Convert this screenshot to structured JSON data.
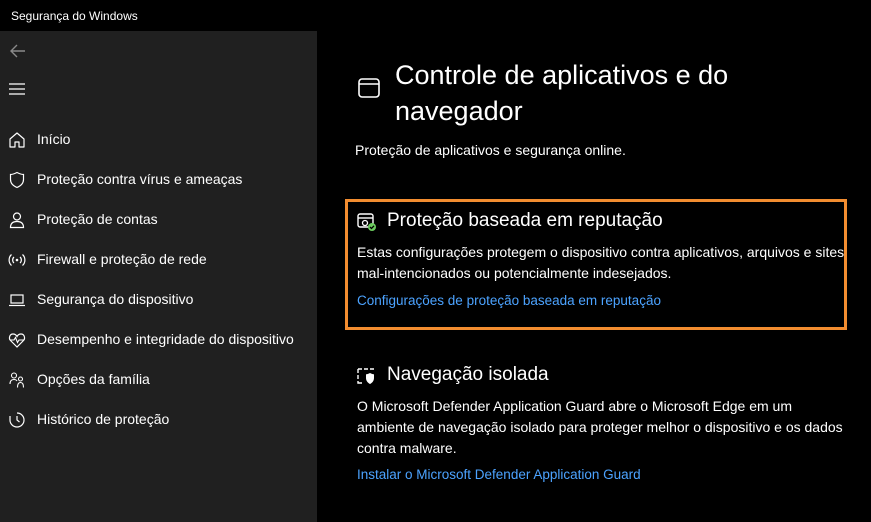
{
  "app": {
    "title": "Segurança do Windows"
  },
  "sidebar": {
    "back_icon": "back-arrow-icon",
    "menu_icon": "hamburger-menu-icon",
    "items": [
      {
        "label": "Início",
        "icon": "home-icon"
      },
      {
        "label": "Proteção contra vírus e ameaças",
        "icon": "shield-icon"
      },
      {
        "label": "Proteção de contas",
        "icon": "person-icon"
      },
      {
        "label": "Firewall e proteção de rede",
        "icon": "wifi-icon"
      },
      {
        "label": "Segurança do dispositivo",
        "icon": "laptop-icon"
      },
      {
        "label": "Desempenho e integridade do dispositivo",
        "icon": "heart-pulse-icon"
      },
      {
        "label": "Opções da família",
        "icon": "family-icon"
      },
      {
        "label": "Histórico de proteção",
        "icon": "history-icon"
      }
    ]
  },
  "main": {
    "title": "Controle de aplicativos e do navegador",
    "subtitle": "Proteção de aplicativos e segurança online.",
    "sections": [
      {
        "title": "Proteção baseada em reputação",
        "description": "Estas configurações protegem o dispositivo contra aplicativos, arquivos e sites mal-intencionados ou potencialmente indesejados.",
        "link": "Configurações de proteção baseada em reputação",
        "icon": "reputation-check-icon"
      },
      {
        "title": "Navegação isolada",
        "description": "O Microsoft Defender Application Guard abre o Microsoft Edge em um ambiente de navegação isolado para proteger melhor o dispositivo e os dados contra malware.",
        "link": "Instalar o Microsoft Defender Application Guard",
        "icon": "isolated-browsing-icon"
      }
    ]
  },
  "colors": {
    "link": "#4ca3ff",
    "highlight": "#f28d30",
    "sidebar_bg": "#202020",
    "main_bg": "#000000",
    "check_green": "#6ccb5f"
  }
}
